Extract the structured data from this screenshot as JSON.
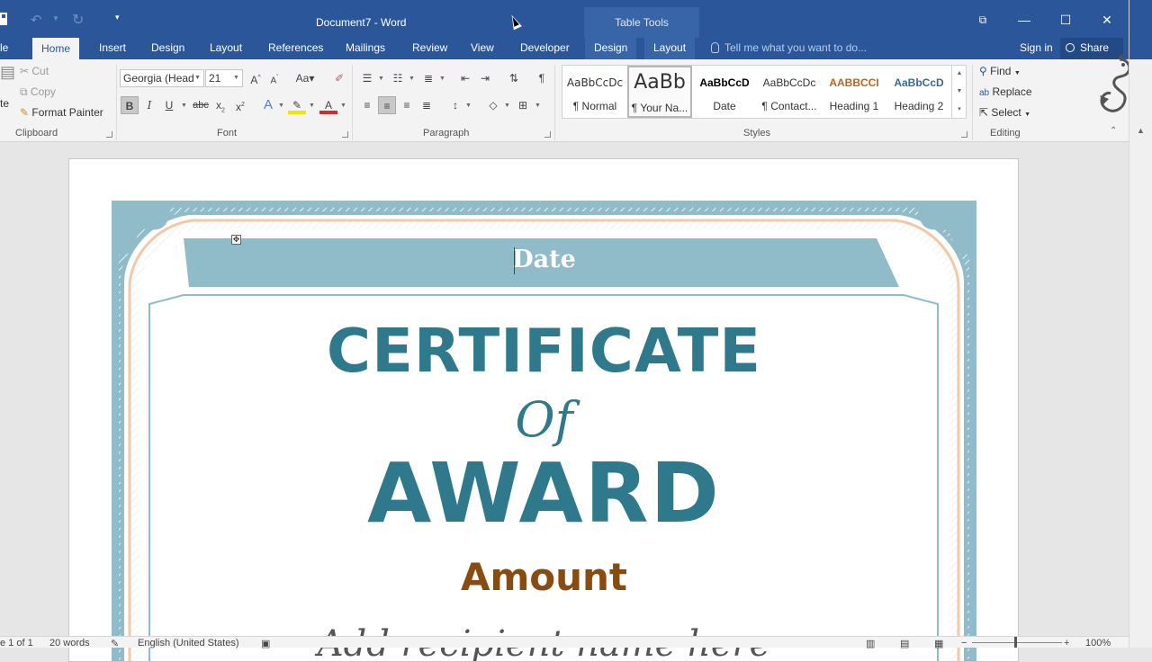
{
  "window": {
    "title": "Document7 - Word",
    "contextual_tab_group": "Table Tools"
  },
  "quick_access": {
    "icons": [
      "save-icon",
      "undo-icon",
      "redo-icon",
      "customize-icon"
    ]
  },
  "ribbon_tabs": {
    "file": "le",
    "home": "Home",
    "insert": "Insert",
    "design": "Design",
    "layout": "Layout",
    "references": "References",
    "mailings": "Mailings",
    "review": "Review",
    "view": "View",
    "developer": "Developer",
    "table_design": "Design",
    "table_layout": "Layout",
    "tell_me_placeholder": "Tell me what you want to do...",
    "sign_in": "Sign in",
    "share": "Share"
  },
  "clipboard": {
    "cut": "Cut",
    "copy": "Copy",
    "format_painter": "Format Painter",
    "paste_fragment": "te",
    "label": "Clipboard"
  },
  "font": {
    "family": "Georgia (Head",
    "size": "21",
    "label": "Font"
  },
  "paragraph": {
    "label": "Paragraph"
  },
  "styles": {
    "label": "Styles",
    "items": [
      {
        "preview": "AaBbCcDc",
        "name": "¶ Normal"
      },
      {
        "preview": "AaBb",
        "name": "¶ Your Na..."
      },
      {
        "preview": "AaBbCcD",
        "name": "Date"
      },
      {
        "preview": "AaBbCcDc",
        "name": "¶ Contact..."
      },
      {
        "preview": "AABBCCI",
        "name": "Heading 1"
      },
      {
        "preview": "AaBbCcD",
        "name": "Heading 2"
      }
    ]
  },
  "editing": {
    "label": "Editing",
    "find": "Find",
    "replace": "Replace",
    "select": "Select"
  },
  "document": {
    "date": "Date",
    "certificate": "CERTIFICATE",
    "of": "Of",
    "award": "AWARD",
    "amount": "Amount",
    "next_line_partial": "Add recipient name here"
  },
  "status": {
    "page": "e 1 of 1",
    "words": "20 words",
    "language": "English (United States)",
    "zoom": "100%"
  },
  "colors": {
    "word_blue": "#2b579a",
    "certificate_teal": "#2e7a8c",
    "frame_blue": "#8fbcc8",
    "frame_peach": "#f2c9a4",
    "amount_brown": "#8a4b0f"
  }
}
